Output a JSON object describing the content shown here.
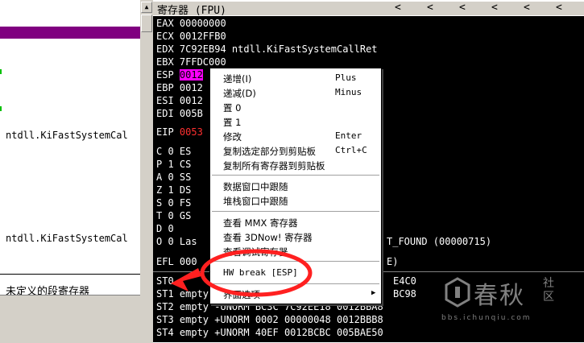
{
  "left_pane": {
    "texts": [
      "ntdll.KiFastSystemCal",
      "ntdll.KiFastSystemCal"
    ],
    "bottom_text": "未定义的段寄存器"
  },
  "register_pane": {
    "title": "寄存器 (FPU)",
    "title_arrows": [
      "<",
      "<",
      "<",
      "<",
      "<",
      "<"
    ],
    "rows": [
      {
        "text": "EAX 00000000"
      },
      {
        "text": "ECX 0012FFB0"
      },
      {
        "text": "EDX 7C92EB94 ntdll.KiFastSystemCallRet"
      },
      {
        "text": "EBX 7FFDC000"
      },
      {
        "name": "ESP",
        "value": "0012"
      },
      {
        "text": "EBP 0012"
      },
      {
        "text": "ESI 0012"
      },
      {
        "text": "EDI 005B"
      },
      {
        "name": "EIP",
        "value": "0053"
      },
      {
        "text": "C 0  ES"
      },
      {
        "text": "P 1  CS"
      },
      {
        "text": "A 0  SS"
      },
      {
        "text": "Z 1  DS"
      },
      {
        "text": "S 0  FS"
      },
      {
        "text": "T 0  GS"
      },
      {
        "text": "D 0"
      },
      {
        "text": "O 0  Las",
        "tail": "T_FOUND (00000715)"
      },
      {
        "text": "EFL 000",
        "tail": "E)"
      },
      {
        "text": "ST0",
        "tail": "E4C0"
      },
      {
        "text": "ST1 empty",
        "tail": "BC98"
      },
      {
        "text": "ST2 empty -UNORM BC3C 7C92EE18 0012BBA8"
      },
      {
        "text": "ST3 empty +UNORM 0002 00000048 0012BBB8"
      },
      {
        "text": "ST4 empty +UNORM 40EF 0012BCBC 005BAE50"
      }
    ]
  },
  "context_menu": {
    "items": [
      {
        "label": "递增(I)",
        "accel": "Plus"
      },
      {
        "label": "递减(D)",
        "accel": "Minus"
      },
      {
        "label": "置 0",
        "accel": ""
      },
      {
        "label": "置 1",
        "accel": ""
      },
      {
        "label": "修改",
        "accel": "Enter"
      },
      {
        "label": "复制选定部分到剪贴板",
        "accel": "Ctrl+C"
      },
      {
        "label": "复制所有寄存器到剪贴板",
        "accel": ""
      },
      {
        "label": "数据窗口中跟随",
        "accel": ""
      },
      {
        "label": "堆栈窗口中跟随",
        "accel": ""
      },
      {
        "label": "查看 MMX 寄存器",
        "accel": ""
      },
      {
        "label": "查看 3DNow! 寄存器",
        "accel": ""
      },
      {
        "label": "查看调试寄存器",
        "accel": ""
      },
      {
        "label": "HW break [ESP]",
        "accel": ""
      },
      {
        "label": "界面选项",
        "accel": ""
      }
    ]
  },
  "annotation": {
    "color": "#ff2020"
  },
  "watermark": {
    "brand": "春秋",
    "side": "社区",
    "site": "bbs.ichunqiu.com"
  }
}
